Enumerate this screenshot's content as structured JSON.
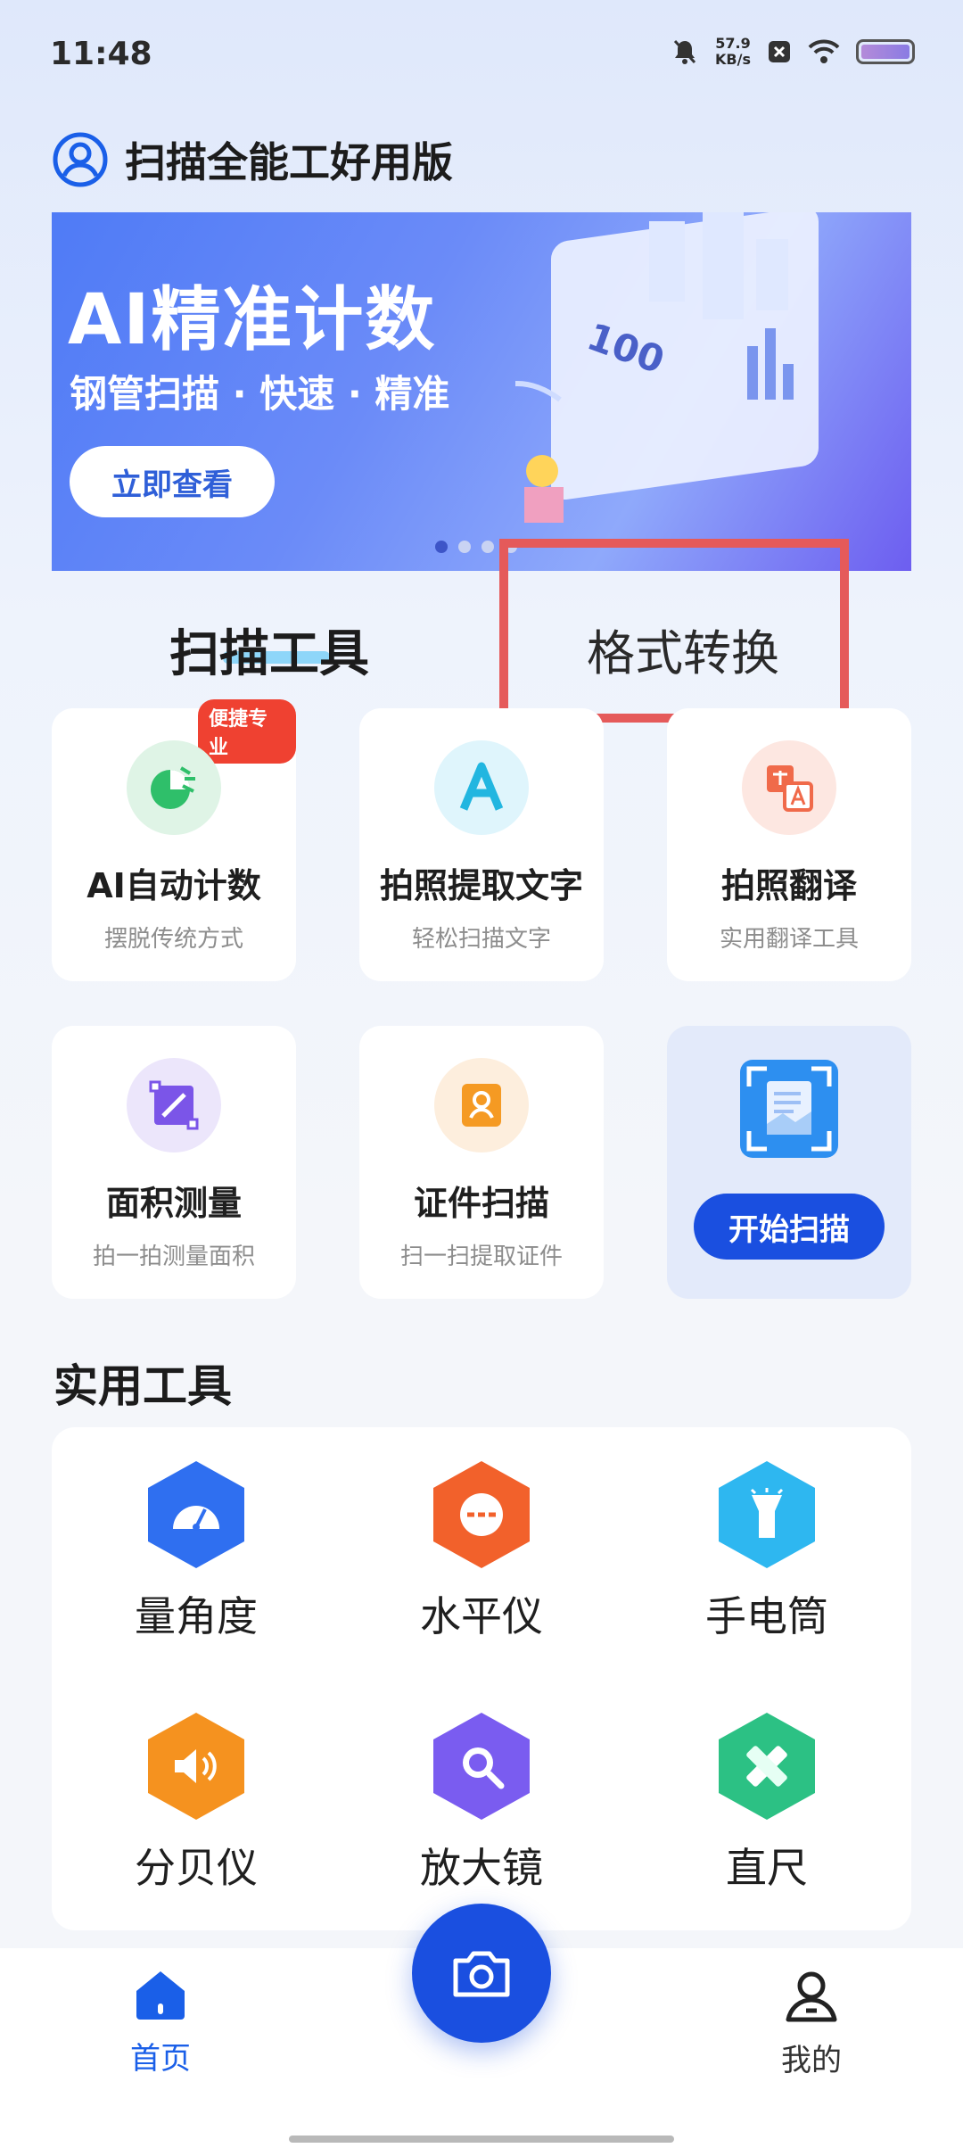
{
  "status_bar": {
    "time": "11:48",
    "speed_value": "57.9",
    "speed_unit": "KB/s"
  },
  "header": {
    "title": "扫描全能工好用版"
  },
  "banner": {
    "title": "AI精准计数",
    "subtitle": "钢管扫描 · 快速 · 精准",
    "button": "立即查看",
    "chart_label": "100"
  },
  "tabs": [
    {
      "label": "扫描工具"
    },
    {
      "label": "格式转换"
    }
  ],
  "scan_tools": [
    {
      "title": "AI自动计数",
      "subtitle": "摆脱传统方式",
      "badge": "便捷专业",
      "icon": "pie-chart-icon",
      "color": "#2fbf6a"
    },
    {
      "title": "拍照提取文字",
      "subtitle": "轻松扫描文字",
      "icon": "letter-a-icon",
      "color": "#22b6e0"
    },
    {
      "title": "拍照翻译",
      "subtitle": "实用翻译工具",
      "icon": "translate-icon",
      "color": "#f06a4a"
    },
    {
      "title": "面积测量",
      "subtitle": "拍一拍测量面积",
      "icon": "area-measure-icon",
      "color": "#7b55e8"
    },
    {
      "title": "证件扫描",
      "subtitle": "扫一扫提取证件",
      "icon": "id-card-icon",
      "color": "#f59a23"
    }
  ],
  "start_scan": {
    "label": "开始扫描"
  },
  "practical": {
    "title": "实用工具",
    "tools": [
      {
        "label": "量角度",
        "icon": "protractor-icon",
        "color": "#2f6ff0"
      },
      {
        "label": "水平仪",
        "icon": "level-icon",
        "color": "#f2612b"
      },
      {
        "label": "手电筒",
        "icon": "flashlight-icon",
        "color": "#2eb7f0"
      },
      {
        "label": "分贝仪",
        "icon": "speaker-icon",
        "color": "#f5921f"
      },
      {
        "label": "放大镜",
        "icon": "magnifier-icon",
        "color": "#7a5cf0"
      },
      {
        "label": "直尺",
        "icon": "ruler-icon",
        "color": "#2cc184"
      }
    ]
  },
  "nav": {
    "home": "首页",
    "mine": "我的"
  }
}
